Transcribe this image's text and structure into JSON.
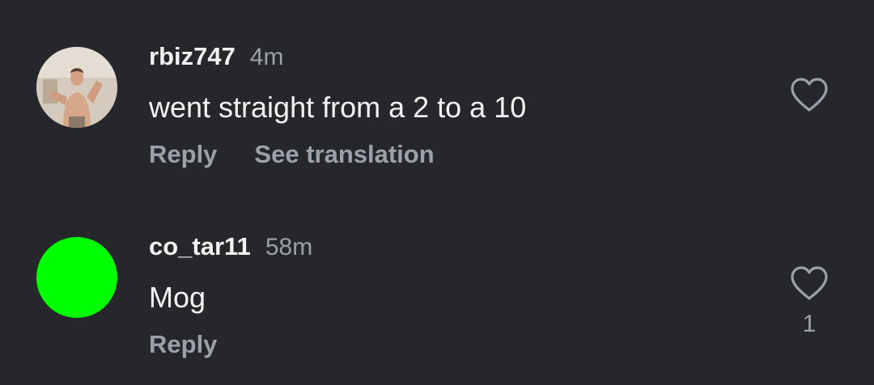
{
  "comments": [
    {
      "username": "rbiz747",
      "time": "4m",
      "text": "went straight from a 2 to a 10",
      "actions": [
        "Reply",
        "See translation"
      ],
      "likes": ""
    },
    {
      "username": "co_tar11",
      "time": "58m",
      "text": "Mog",
      "actions": [
        "Reply"
      ],
      "likes": "1"
    }
  ],
  "colors": {
    "background": "#25272b",
    "primary_text": "#f2f2f2",
    "secondary_text": "#9ba1a9",
    "avatar_2": "#00ff00"
  },
  "icons": {
    "like": "heart-outline-icon"
  }
}
